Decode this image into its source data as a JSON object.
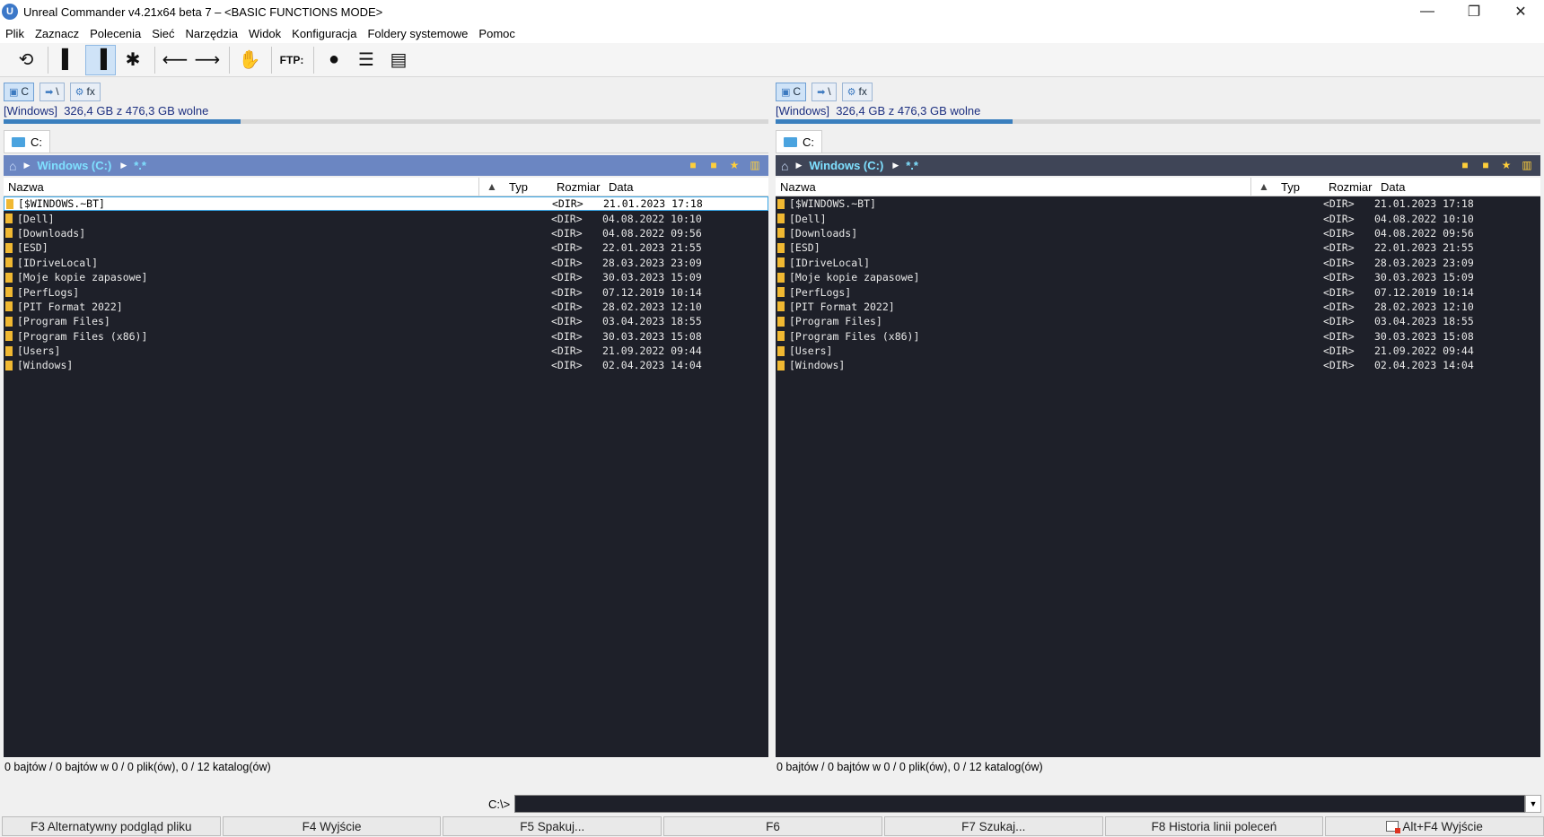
{
  "window": {
    "title": "Unreal Commander v4.21x64 beta 7 – <BASIC FUNCTIONS MODE>",
    "minimize": "—",
    "maximize": "❐",
    "close": "✕"
  },
  "menu": [
    "Plik",
    "Zaznacz",
    "Polecenia",
    "Sieć",
    "Narzędzia",
    "Widok",
    "Konfiguracja",
    "Foldery systemowe",
    "Pomoc"
  ],
  "toolbar": {
    "ftp_label": "FTP:"
  },
  "panels": {
    "left": {
      "drive_buttons": [
        "C",
        "\\",
        "fx"
      ],
      "disk_label": "[Windows]",
      "disk_free": "326,4 GB z 476,3 GB wolne",
      "disk_used_fraction": 0.31,
      "tab_label": "C:",
      "path": "Windows (C:)",
      "mask": "*.*",
      "columns": {
        "name": "Nazwa",
        "type": "Typ",
        "size": "Rozmiar",
        "date": "Data"
      },
      "status": "0 bajtów / 0 bajtów w 0 / 0 plik(ów), 0 / 12 katalog(ów)"
    },
    "right": {
      "drive_buttons": [
        "C",
        "\\",
        "fx"
      ],
      "disk_label": "[Windows]",
      "disk_free": "326,4 GB z 476,3 GB wolne",
      "disk_used_fraction": 0.31,
      "tab_label": "C:",
      "path": "Windows (C:)",
      "mask": "*.*",
      "columns": {
        "name": "Nazwa",
        "type": "Typ",
        "size": "Rozmiar",
        "date": "Data"
      },
      "status": "0 bajtów / 0 bajtów w 0 / 0 plik(ów), 0 / 12 katalog(ów)"
    }
  },
  "files": [
    {
      "name": "[$WINDOWS.~BT]",
      "size": "<DIR>",
      "date": "21.01.2023 17:18"
    },
    {
      "name": "[Dell]",
      "size": "<DIR>",
      "date": "04.08.2022 10:10"
    },
    {
      "name": "[Downloads]",
      "size": "<DIR>",
      "date": "04.08.2022 09:56"
    },
    {
      "name": "[ESD]",
      "size": "<DIR>",
      "date": "22.01.2023 21:55"
    },
    {
      "name": "[IDriveLocal]",
      "size": "<DIR>",
      "date": "28.03.2023 23:09"
    },
    {
      "name": "[Moje kopie zapasowe]",
      "size": "<DIR>",
      "date": "30.03.2023 15:09"
    },
    {
      "name": "[PerfLogs]",
      "size": "<DIR>",
      "date": "07.12.2019 10:14"
    },
    {
      "name": "[PIT Format 2022]",
      "size": "<DIR>",
      "date": "28.02.2023 12:10"
    },
    {
      "name": "[Program Files]",
      "size": "<DIR>",
      "date": "03.04.2023 18:55"
    },
    {
      "name": "[Program Files (x86)]",
      "size": "<DIR>",
      "date": "30.03.2023 15:08"
    },
    {
      "name": "[Users]",
      "size": "<DIR>",
      "date": "21.09.2022 09:44"
    },
    {
      "name": "[Windows]",
      "size": "<DIR>",
      "date": "02.04.2023 14:04"
    }
  ],
  "cmdline": {
    "prompt": "C:\\>",
    "value": ""
  },
  "fkeys": [
    "F3 Alternatywny podgląd pliku",
    "F4 Wyjście",
    "F5 Spakuj...",
    "F6",
    "F7 Szukaj...",
    "F8 Historia linii poleceń",
    "Alt+F4 Wyjście"
  ]
}
